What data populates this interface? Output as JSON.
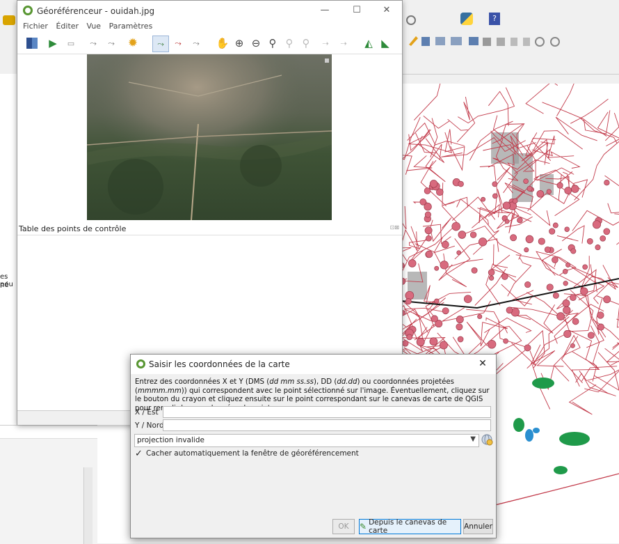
{
  "colors": {
    "qgis_green": "#589632",
    "road_red": "#c23a4a",
    "poi_pink": "#d86a7e",
    "accent_blue": "#0078d7"
  },
  "background": {
    "left_panel_text": [
      "es pou",
      "né"
    ]
  },
  "georef": {
    "title": "Géoréférenceur - ouidah.jpg",
    "menu": [
      "Fichier",
      "Éditer",
      "Vue",
      "Paramètres"
    ],
    "window_buttons": {
      "minimize": "—",
      "maximize": "☐",
      "close": "✕"
    },
    "gcp_title": "Table des points de contrôle",
    "toolbar_icons": [
      "open-raster-icon",
      "start-georef-icon",
      "generate-script-icon",
      "load-gcp-icon",
      "save-gcp-icon",
      "settings-icon",
      "add-point-icon",
      "delete-point-icon",
      "move-point-icon",
      "pan-icon",
      "zoom-in-icon",
      "zoom-out-icon",
      "zoom-layer-icon",
      "zoom-last-icon",
      "zoom-next-icon",
      "link-georef-icon",
      "link-qgis-icon",
      "full-histogram-icon",
      "local-histogram-icon"
    ]
  },
  "dialog": {
    "title": "Saisir les coordonnées de la carte",
    "close": "✕",
    "desc_part1": "Entrez des coordonnées X et Y (DMS (",
    "desc_dms": "dd mm ss.ss",
    "desc_part2": "), DD (",
    "desc_dd": "dd.dd",
    "desc_part3": ") ou coordonnées projetées (",
    "desc_proj": "mmmm.mm",
    "desc_part4": ")) qui correspondent avec le point sélectionné sur l'image. Éventuellement, cliquez sur le bouton du crayon et cliquez ensuite sur le point correspondant sur le canevas de carte de QGIS pour remplir les coordonnées du point.",
    "x_label": "X / Est",
    "x_value": "",
    "y_label": "Y / Nord",
    "y_value": "",
    "projection": "projection invalide",
    "checkbox_label": "Cacher automatiquement la fenêtre de géoréférencement",
    "checkbox_checked": true,
    "ok": "OK",
    "from_canvas": "Depuis le canevas de carte",
    "cancel": "Annuler"
  }
}
